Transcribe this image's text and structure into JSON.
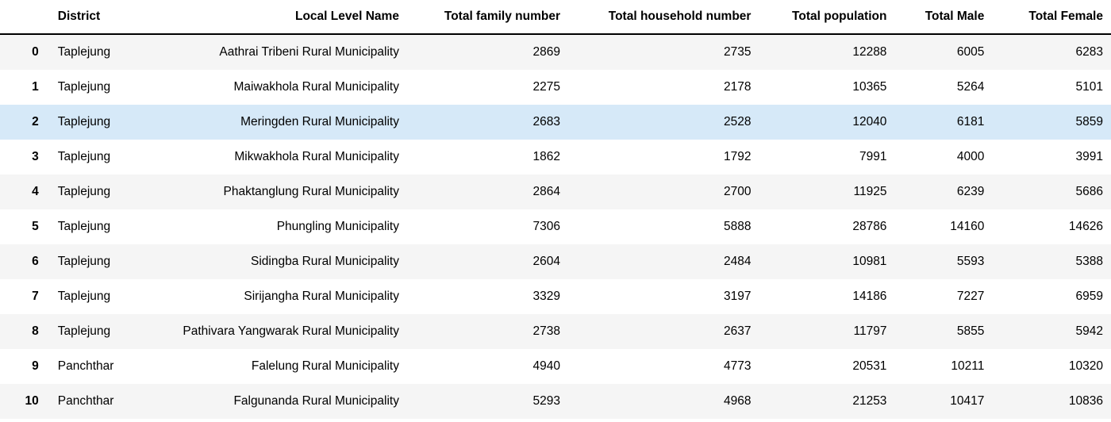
{
  "table": {
    "columns": [
      "District",
      "Local Level Name",
      "Total family number",
      "Total household number",
      "Total population",
      "Total Male",
      "Total Female"
    ],
    "highlight_index": 2,
    "rows": [
      {
        "idx": "0",
        "district": "Taplejung",
        "name": "Aathrai Tribeni Rural Municipality",
        "family": "2869",
        "household": "2735",
        "population": "12288",
        "male": "6005",
        "female": "6283"
      },
      {
        "idx": "1",
        "district": "Taplejung",
        "name": "Maiwakhola Rural Municipality",
        "family": "2275",
        "household": "2178",
        "population": "10365",
        "male": "5264",
        "female": "5101"
      },
      {
        "idx": "2",
        "district": "Taplejung",
        "name": "Meringden Rural Municipality",
        "family": "2683",
        "household": "2528",
        "population": "12040",
        "male": "6181",
        "female": "5859"
      },
      {
        "idx": "3",
        "district": "Taplejung",
        "name": "Mikwakhola Rural Municipality",
        "family": "1862",
        "household": "1792",
        "population": "7991",
        "male": "4000",
        "female": "3991"
      },
      {
        "idx": "4",
        "district": "Taplejung",
        "name": "Phaktanglung Rural Municipality",
        "family": "2864",
        "household": "2700",
        "population": "11925",
        "male": "6239",
        "female": "5686"
      },
      {
        "idx": "5",
        "district": "Taplejung",
        "name": "Phungling Municipality",
        "family": "7306",
        "household": "5888",
        "population": "28786",
        "male": "14160",
        "female": "14626"
      },
      {
        "idx": "6",
        "district": "Taplejung",
        "name": "Sidingba Rural Municipality",
        "family": "2604",
        "household": "2484",
        "population": "10981",
        "male": "5593",
        "female": "5388"
      },
      {
        "idx": "7",
        "district": "Taplejung",
        "name": "Sirijangha Rural Municipality",
        "family": "3329",
        "household": "3197",
        "population": "14186",
        "male": "7227",
        "female": "6959"
      },
      {
        "idx": "8",
        "district": "Taplejung",
        "name": "Pathivara Yangwarak Rural Municipality",
        "family": "2738",
        "household": "2637",
        "population": "11797",
        "male": "5855",
        "female": "5942"
      },
      {
        "idx": "9",
        "district": "Panchthar",
        "name": "Falelung Rural Municipality",
        "family": "4940",
        "household": "4773",
        "population": "20531",
        "male": "10211",
        "female": "10320"
      },
      {
        "idx": "10",
        "district": "Panchthar",
        "name": "Falgunanda Rural Municipality",
        "family": "5293",
        "household": "4968",
        "population": "21253",
        "male": "10417",
        "female": "10836"
      }
    ]
  }
}
